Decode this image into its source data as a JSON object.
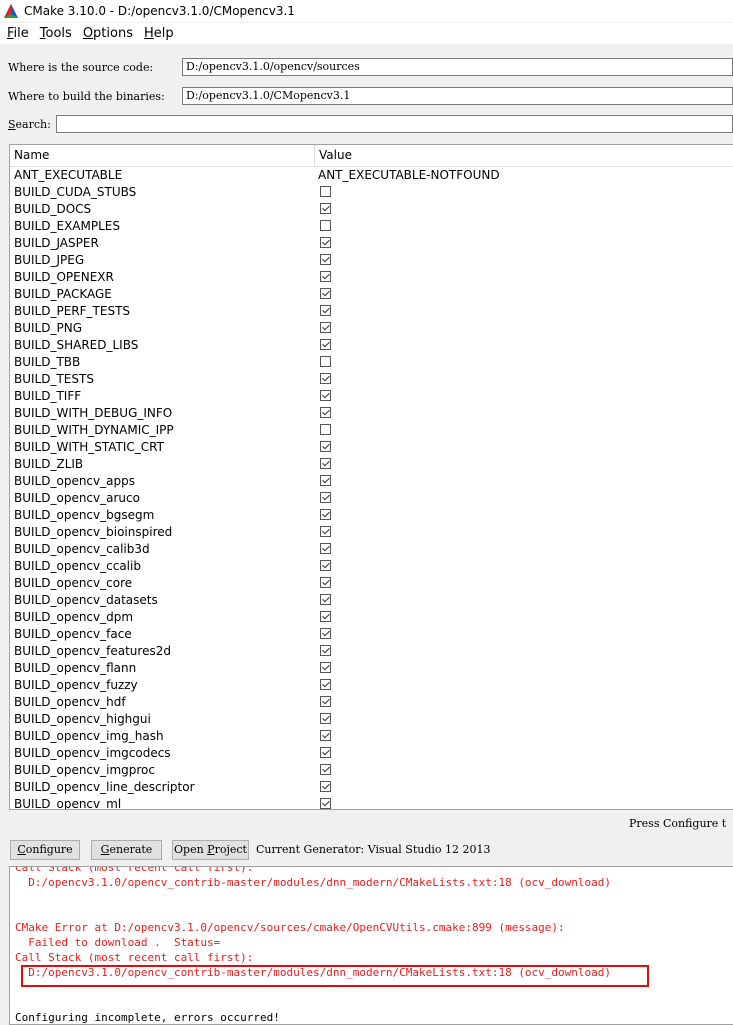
{
  "window": {
    "title": "CMake 3.10.0 - D:/opencv3.1.0/CMopencv3.1"
  },
  "menu": [
    {
      "key": "F",
      "rest": "ile"
    },
    {
      "key": "T",
      "rest": "ools"
    },
    {
      "key": "O",
      "rest": "ptions"
    },
    {
      "key": "H",
      "rest": "elp"
    }
  ],
  "source": {
    "label": "Where is the source code:",
    "value": "D:/opencv3.1.0/opencv/sources"
  },
  "build": {
    "label": "Where to build the binaries:",
    "value": "D:/opencv3.1.0/CMopencv3.1"
  },
  "search": {
    "label": "Search:",
    "value": ""
  },
  "table": {
    "headers": {
      "name": "Name",
      "value": "Value"
    },
    "rows": [
      {
        "name": "ANT_EXECUTABLE",
        "type": "text",
        "value": "ANT_EXECUTABLE-NOTFOUND"
      },
      {
        "name": "BUILD_CUDA_STUBS",
        "type": "bool",
        "checked": false
      },
      {
        "name": "BUILD_DOCS",
        "type": "bool",
        "checked": true
      },
      {
        "name": "BUILD_EXAMPLES",
        "type": "bool",
        "checked": false
      },
      {
        "name": "BUILD_JASPER",
        "type": "bool",
        "checked": true
      },
      {
        "name": "BUILD_JPEG",
        "type": "bool",
        "checked": true
      },
      {
        "name": "BUILD_OPENEXR",
        "type": "bool",
        "checked": true
      },
      {
        "name": "BUILD_PACKAGE",
        "type": "bool",
        "checked": true
      },
      {
        "name": "BUILD_PERF_TESTS",
        "type": "bool",
        "checked": true
      },
      {
        "name": "BUILD_PNG",
        "type": "bool",
        "checked": true
      },
      {
        "name": "BUILD_SHARED_LIBS",
        "type": "bool",
        "checked": true
      },
      {
        "name": "BUILD_TBB",
        "type": "bool",
        "checked": false
      },
      {
        "name": "BUILD_TESTS",
        "type": "bool",
        "checked": true
      },
      {
        "name": "BUILD_TIFF",
        "type": "bool",
        "checked": true
      },
      {
        "name": "BUILD_WITH_DEBUG_INFO",
        "type": "bool",
        "checked": true
      },
      {
        "name": "BUILD_WITH_DYNAMIC_IPP",
        "type": "bool",
        "checked": false
      },
      {
        "name": "BUILD_WITH_STATIC_CRT",
        "type": "bool",
        "checked": true
      },
      {
        "name": "BUILD_ZLIB",
        "type": "bool",
        "checked": true
      },
      {
        "name": "BUILD_opencv_apps",
        "type": "bool",
        "checked": true
      },
      {
        "name": "BUILD_opencv_aruco",
        "type": "bool",
        "checked": true
      },
      {
        "name": "BUILD_opencv_bgsegm",
        "type": "bool",
        "checked": true
      },
      {
        "name": "BUILD_opencv_bioinspired",
        "type": "bool",
        "checked": true
      },
      {
        "name": "BUILD_opencv_calib3d",
        "type": "bool",
        "checked": true
      },
      {
        "name": "BUILD_opencv_ccalib",
        "type": "bool",
        "checked": true
      },
      {
        "name": "BUILD_opencv_core",
        "type": "bool",
        "checked": true
      },
      {
        "name": "BUILD_opencv_datasets",
        "type": "bool",
        "checked": true
      },
      {
        "name": "BUILD_opencv_dpm",
        "type": "bool",
        "checked": true
      },
      {
        "name": "BUILD_opencv_face",
        "type": "bool",
        "checked": true
      },
      {
        "name": "BUILD_opencv_features2d",
        "type": "bool",
        "checked": true
      },
      {
        "name": "BUILD_opencv_flann",
        "type": "bool",
        "checked": true
      },
      {
        "name": "BUILD_opencv_fuzzy",
        "type": "bool",
        "checked": true
      },
      {
        "name": "BUILD_opencv_hdf",
        "type": "bool",
        "checked": true
      },
      {
        "name": "BUILD_opencv_highgui",
        "type": "bool",
        "checked": true
      },
      {
        "name": "BUILD_opencv_img_hash",
        "type": "bool",
        "checked": true
      },
      {
        "name": "BUILD_opencv_imgcodecs",
        "type": "bool",
        "checked": true
      },
      {
        "name": "BUILD_opencv_imgproc",
        "type": "bool",
        "checked": true
      },
      {
        "name": "BUILD_opencv_line_descriptor",
        "type": "bool",
        "checked": true
      },
      {
        "name": "BUILD_opencv_ml",
        "type": "bool",
        "checked": true
      }
    ]
  },
  "status": {
    "press_text": "Press Configure t"
  },
  "buttons": {
    "configure": {
      "key": "C",
      "rest": "onfigure"
    },
    "generate": {
      "key": "G",
      "rest": "enerate"
    },
    "open_project": {
      "pre": "Open ",
      "key": "P",
      "rest": "roject"
    }
  },
  "generator": {
    "text": "Current Generator: Visual Studio 12 2013"
  },
  "log": {
    "lines": [
      {
        "text": "Call Stack (most recent call first):",
        "color": "red"
      },
      {
        "text": "  D:/opencv3.1.0/opencv_contrib-master/modules/dnn_modern/CMakeLists.txt:18 (ocv_download)",
        "color": "red"
      },
      {
        "text": "",
        "color": "red"
      },
      {
        "text": "",
        "color": "red"
      },
      {
        "text": "CMake Error at D:/opencv3.1.0/opencv/sources/cmake/OpenCVUtils.cmake:899 (message):",
        "color": "red"
      },
      {
        "text": "  Failed to download .  Status=",
        "color": "red"
      },
      {
        "text": "Call Stack (most recent call first):",
        "color": "red"
      },
      {
        "text": "  D:/opencv3.1.0/opencv_contrib-master/modules/dnn_modern/CMakeLists.txt:18 (ocv_download)",
        "color": "red"
      },
      {
        "text": "",
        "color": "black"
      },
      {
        "text": "",
        "color": "black"
      },
      {
        "text": "Configuring incomplete, errors occurred!",
        "color": "black"
      }
    ]
  },
  "colors": {
    "error": "#e02020",
    "highlight": "#d81010"
  }
}
